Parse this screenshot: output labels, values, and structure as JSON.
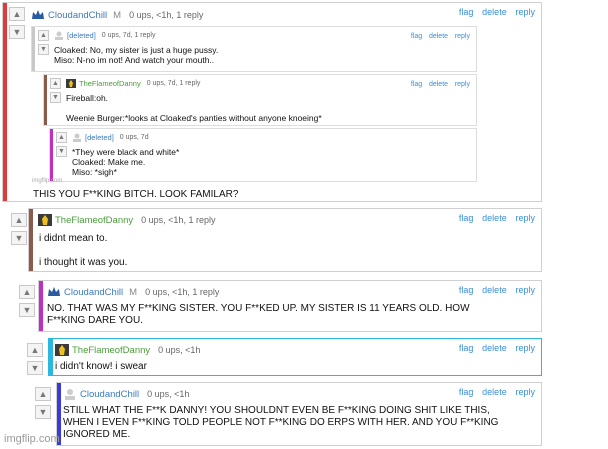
{
  "comments": [
    {
      "user": "CloudandChill",
      "mod": "M",
      "meta": "0 ups, <1h, 1 reply",
      "actions": [
        "flag",
        "delete",
        "reply"
      ],
      "text": "THIS YOU F**KING BITCH. LOOK FAMILAR?",
      "bar_color": "#e03a3a"
    },
    {
      "user": "TheFlameofDanny",
      "meta": "0 ups, <1h, 1 reply",
      "actions": [
        "flag",
        "delete",
        "reply"
      ],
      "text": "i didnt mean to.\n\ni thought it was you.",
      "bar_color": "#8a5a4a"
    },
    {
      "user": "CloudandChill",
      "mod": "M",
      "meta": "0 ups, <1h, 1 reply",
      "actions": [
        "flag",
        "delete",
        "reply"
      ],
      "text": "NO. THAT WAS MY F**KING SISTER. YOU F**KED UP. MY SISTER IS 11 YEARS OLD. HOW\nF**KING DARE YOU.",
      "bar_color": "#c02fc0"
    },
    {
      "user": "TheFlameofDanny",
      "meta": "0 ups, <1h",
      "actions": [
        "flag",
        "delete",
        "reply"
      ],
      "text": "i didn't know! i swear",
      "bar_color": "#2ab8e0"
    },
    {
      "user": "CloudandChill",
      "meta": "0 ups, <1h",
      "actions": [
        "flag",
        "delete",
        "reply"
      ],
      "text": "STILL WHAT THE F**K DANNY! YOU SHOULDNT EVEN BE F**KING DOING SHIT LIKE THIS,\nWHEN I EVEN F**KING TOLD PEOPLE NOT F**KING DO ERPS WITH HER. AND YOU F**KING\nIGNORED ME.",
      "bar_color": "#3a3adf"
    }
  ],
  "embedded": [
    {
      "user": "[deleted]",
      "meta": "0 ups, 7d, 1 reply",
      "actions": [
        "flag",
        "delete",
        "reply"
      ],
      "text": "Cloaked: No, my sister is just a huge pussy.\nMiso: N-no im not! And watch your mouth..",
      "bar_color": "#c8c8c8"
    },
    {
      "user": "TheFlameofDanny",
      "meta": "0 ups, 7d, 1 reply",
      "actions": [
        "flag",
        "delete",
        "reply"
      ],
      "text": "Fireball:oh.\n\nWeenie Burger:*looks at Cloaked's panties without anyone knoeing*",
      "bar_color": "#8a5a4a"
    },
    {
      "user": "[deleted]",
      "meta": "0 ups, 7d",
      "actions": [
        "flag",
        "delete",
        "reply"
      ],
      "text": "*They were black and white*\nCloaked: Make me.\nMiso: *sigh*",
      "bar_color": "#c02fc0"
    }
  ],
  "embed_watermark": "imgflip.com",
  "watermark": "imgflip.com",
  "icons": {
    "upvote": "▲",
    "downvote": "▼"
  }
}
